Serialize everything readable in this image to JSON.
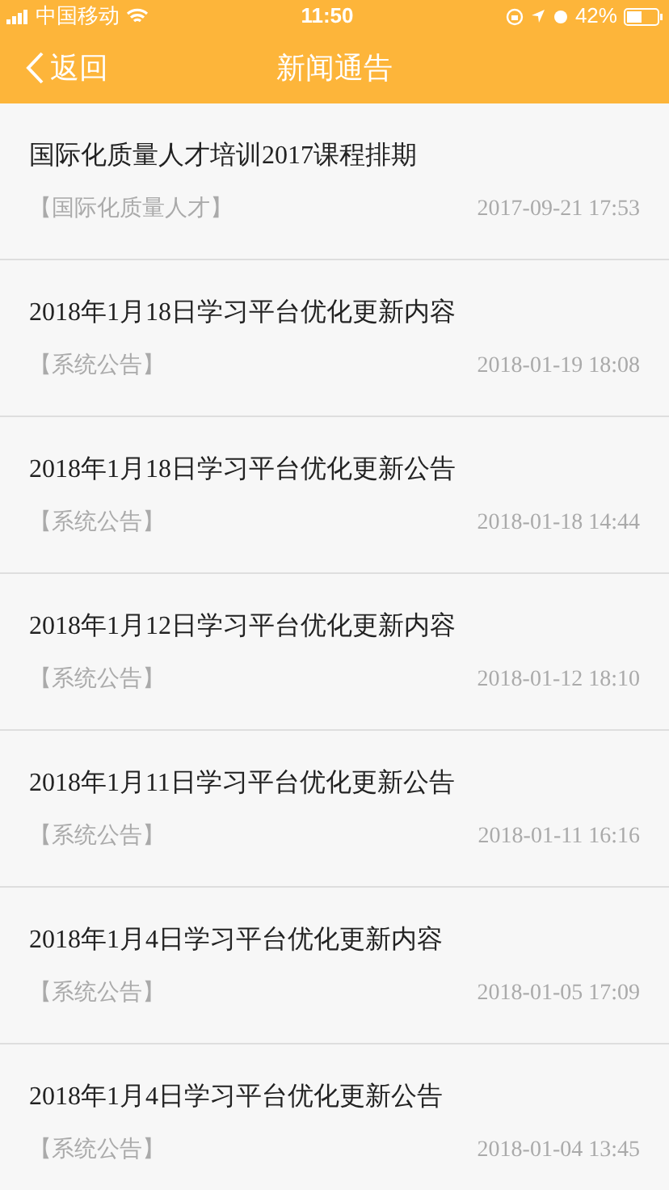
{
  "status_bar": {
    "carrier": "中国移动",
    "time": "11:50",
    "battery": "42%"
  },
  "nav": {
    "back": "返回",
    "title": "新闻通告"
  },
  "news": [
    {
      "title": "国际化质量人才培训2017课程排期",
      "category": "【国际化质量人才】",
      "date": "2017-09-21 17:53"
    },
    {
      "title": "2018年1月18日学习平台优化更新内容",
      "category": "【系统公告】",
      "date": "2018-01-19 18:08"
    },
    {
      "title": "2018年1月18日学习平台优化更新公告",
      "category": "【系统公告】",
      "date": "2018-01-18 14:44"
    },
    {
      "title": "2018年1月12日学习平台优化更新内容",
      "category": "【系统公告】",
      "date": "2018-01-12 18:10"
    },
    {
      "title": "2018年1月11日学习平台优化更新公告",
      "category": "【系统公告】",
      "date": "2018-01-11 16:16"
    },
    {
      "title": "2018年1月4日学习平台优化更新内容",
      "category": "【系统公告】",
      "date": "2018-01-05 17:09"
    },
    {
      "title": "2018年1月4日学习平台优化更新公告",
      "category": "【系统公告】",
      "date": "2018-01-04 13:45"
    }
  ]
}
